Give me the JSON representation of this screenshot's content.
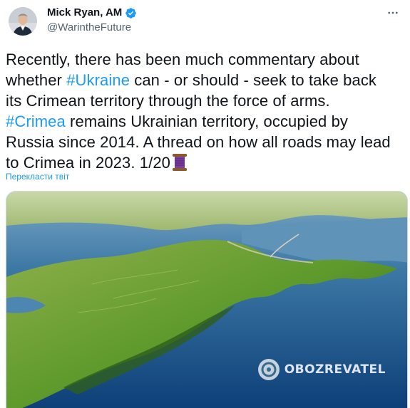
{
  "author": {
    "display_name": "Mick Ryan, AM",
    "handle": "@WarintheFuture",
    "verified": true
  },
  "tweet": {
    "line1": "Recently, there has been much commentary about",
    "line2_pre": "whether ",
    "line2_tag": "#Ukraine",
    "line2_post": " can - or should - seek to take back",
    "line3": "its Crimean territory through the force of arms.",
    "line4_tag": "#Crimea",
    "line4_post": " remains Ukrainian territory, occupied by",
    "line5": "Russia since 2014. A thread on how all roads may lead",
    "line6": "to Crimea in 2023. 1/20",
    "emoji": "thread-spool-icon",
    "translate_label": "Перекласти твіт"
  },
  "media": {
    "image_description_icon": "crimea-satellite-image",
    "watermark_text": "OBOZREVATEL"
  },
  "colors": {
    "link": "#1d9bf0",
    "secondary": "#536471",
    "text": "#0f1419"
  }
}
